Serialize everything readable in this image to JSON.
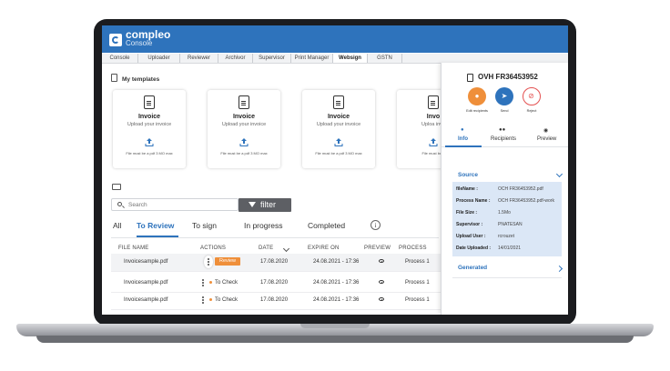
{
  "app": {
    "logo_name": "compleo",
    "logo_sub": "Console"
  },
  "nav": {
    "tabs": [
      "Console",
      "Uploader",
      "Reviewer",
      "Archivor",
      "Supervisor",
      "Print Manager",
      "Websign",
      "GSTN"
    ],
    "active": "Websign"
  },
  "templates": {
    "heading": "My templates",
    "cards": [
      {
        "title": "Invoice",
        "subtitle": "Upload your invoice",
        "note": "File must be a pdf 3 MO max"
      },
      {
        "title": "Invoice",
        "subtitle": "Upload your invoice",
        "note": "File must be a pdf 3 MO max"
      },
      {
        "title": "Invoice",
        "subtitle": "Upload your invoice",
        "note": "File must be a pdf 3 MO max"
      },
      {
        "title": "Invo",
        "subtitle": "Uploa invo",
        "note": "File must be a"
      }
    ]
  },
  "search": {
    "placeholder": "Search",
    "filter_label": "filter"
  },
  "status_tabs": {
    "items": [
      "All",
      "To Review",
      "To sign",
      "In progress",
      "Completed"
    ],
    "active": "To Review",
    "info_glyph": "i"
  },
  "table": {
    "columns": [
      "FILE NAME",
      "ACTIONS",
      "DATE",
      "EXPIRE ON",
      "PREVIEW",
      "PROCESS"
    ],
    "rows": [
      {
        "file": "Invoicesample.pdf",
        "action": "Review",
        "date": "17.08.2020",
        "expire": "24.08.2021 - 17:36",
        "process": "Process 1"
      },
      {
        "file": "Invoicesample.pdf",
        "action": "To Check",
        "date": "17.08.2020",
        "expire": "24.08.2021 - 17:36",
        "process": "Process 1"
      },
      {
        "file": "Invoicesample.pdf",
        "action": "To Check",
        "date": "17.08.2020",
        "expire": "24.08.2021 - 17:36",
        "process": "Process 1"
      }
    ]
  },
  "panel": {
    "title": "OVH FR36453952",
    "actions": [
      {
        "label": "Edit recipients",
        "color": "#ef8f3a",
        "icon": "people-icon"
      },
      {
        "label": "Send",
        "color": "#2e73bc",
        "icon": "send-icon"
      },
      {
        "label": "Reject",
        "color": "#e45151",
        "icon": "reject-icon"
      }
    ],
    "tabs": [
      "Info",
      "Recipients",
      "Preview"
    ],
    "active_tab": "Info",
    "source_label": "Source",
    "details": [
      {
        "key": "fileName :",
        "value": "OCH FR36453952.pdf"
      },
      {
        "key": "Process Name :",
        "value": "OCH FR36453952.pdf-work"
      },
      {
        "key": "File Size :",
        "value": "1.5Mo"
      },
      {
        "key": "Supervisor :",
        "value": "PNATESAN"
      },
      {
        "key": "Upload User :",
        "value": "rcrouzet"
      },
      {
        "key": "Date Uploaded :",
        "value": "14/01/2021"
      }
    ],
    "generated_label": "Generated"
  },
  "colors": {
    "brand": "#2e73bc",
    "review_badge": "#ef8f3a",
    "reject": "#e45151"
  }
}
